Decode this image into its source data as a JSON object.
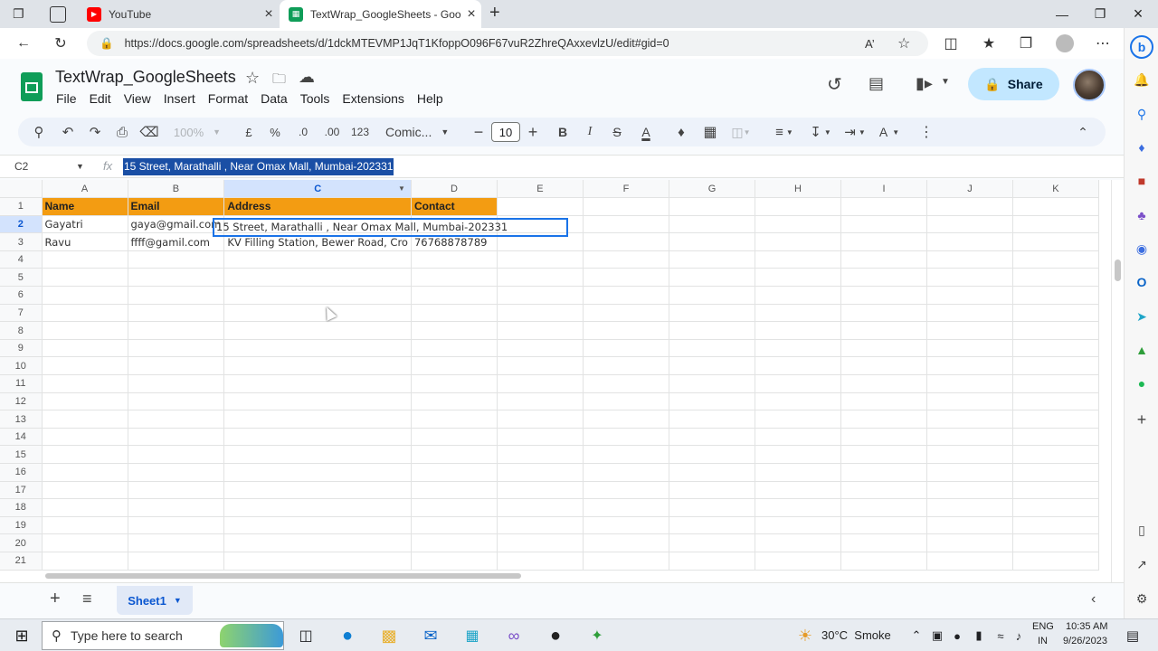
{
  "browser": {
    "tabs": [
      {
        "title": "YouTube"
      },
      {
        "title": "TextWrap_GoogleSheets - Google"
      }
    ],
    "url": "https://docs.google.com/spreadsheets/d/1dckMTEVMP1JqT1KfoppO096F67vuR2ZhreQAxxevlzU/edit#gid=0"
  },
  "sheets": {
    "title": "TextWrap_GoogleSheets",
    "menu": [
      "File",
      "Edit",
      "View",
      "Insert",
      "Format",
      "Data",
      "Tools",
      "Extensions",
      "Help"
    ],
    "share_label": "Share",
    "toolbar": {
      "zoom": "100%",
      "currency": "£",
      "percent": "%",
      "dec_decrease": ".0",
      "dec_increase": ".00",
      "number_format": "123",
      "font": "Comic...",
      "font_size": "10",
      "bold": "B",
      "italic": "I",
      "text_color": "A",
      "text_rotation": "A"
    },
    "name_box": "C2",
    "fx_label": "fx",
    "formula_value": "15 Street, Marathalli , Near Omax Mall, Mumbai-202331",
    "columns": [
      "A",
      "B",
      "C",
      "D",
      "E",
      "F",
      "G",
      "H",
      "I",
      "J",
      "K"
    ],
    "rows": [
      "1",
      "2",
      "3",
      "4",
      "5",
      "6",
      "7",
      "8",
      "9",
      "10",
      "11",
      "12",
      "13",
      "14",
      "15",
      "16",
      "17",
      "18",
      "19",
      "20",
      "21"
    ],
    "cells": {
      "A1": "Name",
      "B1": "Email",
      "C1": "Address",
      "D1": "Contact",
      "A2": "Gayatri",
      "B2": "gaya@gmail.com",
      "C2": "15 Street, Marathalli , Near Omax Mall, Mumbai-202331",
      "A3": "Ravu",
      "B3": "ffff@gamil.com",
      "C3": "KV Filling Station, Bewer Road, Cro",
      "D3": "76768878789"
    },
    "sheet_tab": "Sheet1",
    "header_fill_color": "#f39c12",
    "selection_color": "#1a73e8"
  },
  "taskbar": {
    "search_placeholder": "Type here to search",
    "weather": "30°C  Smoke",
    "lang_line1": "ENG",
    "lang_line2": "IN",
    "time": "10:35 AM",
    "date": "9/26/2023"
  }
}
